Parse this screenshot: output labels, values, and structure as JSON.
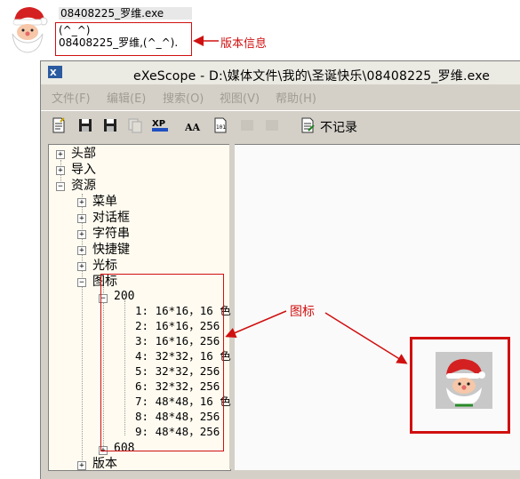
{
  "file_info": {
    "filename": "08408225_罗维.exe",
    "version_line1": "(^_^)",
    "version_line2": "08408225_罗维,(^_^)."
  },
  "annotations": {
    "version_info": "版本信息",
    "icon": "图标"
  },
  "window": {
    "title": "eXeScope - D:\\媒体文件\\我的\\圣诞快乐\\08408225_罗维.exe"
  },
  "menu": [
    "文件(F)",
    "编辑(E)",
    "搜索(O)",
    "视图(V)",
    "帮助(H)"
  ],
  "toolbar": {
    "no_log_label": "不记录"
  },
  "tree": {
    "header": "头部",
    "import": "导入",
    "resources": "资源",
    "menu": "菜单",
    "dialog": "对话框",
    "string": "字符串",
    "accelerator": "快捷键",
    "cursor": "光标",
    "icon": "图标",
    "group_200": "200",
    "icon_entries": [
      "1: 16*16，16 色",
      "2: 16*16，256",
      "3: 16*16，256",
      "4: 32*32，16 色",
      "5: 32*32，256",
      "6: 32*32，256",
      "7: 48*48，16 色",
      "8: 48*48，256",
      "9: 48*48，256"
    ],
    "group_608": "608",
    "version": "版本"
  },
  "colors": {
    "annotation_red": "#d01010",
    "tree_background": "#fffbf0",
    "window_face": "#d4d0c8"
  }
}
